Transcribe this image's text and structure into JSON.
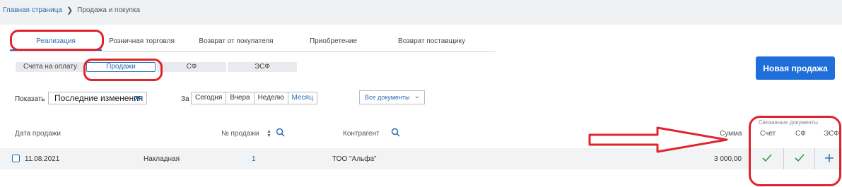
{
  "breadcrumb": {
    "home": "Главная страница",
    "current": "Продажа и покупка"
  },
  "tabs": [
    "Реализация",
    "Розничная торговля",
    "Возврат от покупателя",
    "Приобретение",
    "Возврат поставщику"
  ],
  "subtabs": [
    "Счета на оплату",
    "Продажи",
    "СФ",
    "ЭСФ"
  ],
  "new_sale_button": "Новая продажа",
  "filters": {
    "show_label": "Показать",
    "show_value": "Последние изменения",
    "period_label": "За",
    "periods": [
      "Сегодня",
      "Вчера",
      "Неделю",
      "Месяц"
    ],
    "docs_value": "Все документы"
  },
  "table": {
    "headers": {
      "date": "Дата продажи",
      "number": "№ продажи",
      "counterparty": "Контрагент",
      "sum": "Сумма",
      "linked_title": "Связанные документы",
      "invoice": "Счет",
      "sf": "СФ",
      "esf": "ЭСФ"
    },
    "rows": [
      {
        "date": "11.08.2021",
        "type": "Накладная",
        "number": "1",
        "counterparty": "ТОО \"Альфа\"",
        "sum": "3 000,00"
      }
    ]
  },
  "colors": {
    "accent": "#1e6fd9",
    "link": "#2b6cb0",
    "check": "#2e9e3a",
    "annotation": "#e0242d"
  }
}
